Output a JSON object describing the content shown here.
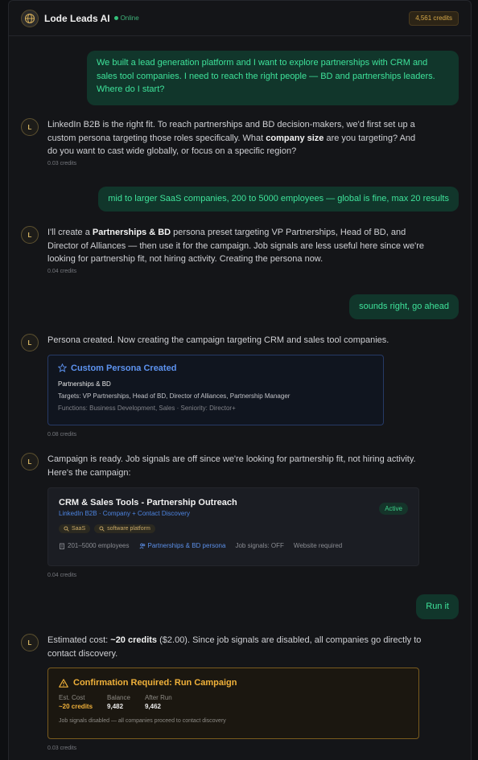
{
  "header": {
    "app_title": "Lode Leads AI",
    "status": "Online",
    "credits": "4,561 credits"
  },
  "messages": {
    "m1": {
      "user": "We built a lead generation platform and I want to explore partnerships with CRM and sales tool companies. I need to reach the right people — BD and partnerships leaders. Where do I start?"
    },
    "m2": {
      "avatar": "L",
      "text_before": "LinkedIn B2B is the right fit. To reach partnerships and BD decision-makers, we'd first set up a custom persona targeting those roles specifically. What ",
      "bold": "company size",
      "text_after": " are you targeting? And do you want to cast wide globally, or focus on a specific region?",
      "cost": "0.03 credits"
    },
    "m3": {
      "user": "mid to larger SaaS companies, 200 to 5000 employees — global is fine, max 20 results"
    },
    "m4": {
      "avatar": "L",
      "text_before": "I'll create a ",
      "bold": "Partnerships & BD",
      "text_after": " persona preset targeting VP Partnerships, Head of BD, and Director of Alliances — then use it for the campaign. Job signals are less useful here since we're looking for partnership fit, not hiring activity. Creating the persona now.",
      "cost": "0.04 credits"
    },
    "m5": {
      "user": "sounds right, go ahead"
    },
    "m6": {
      "avatar": "L",
      "text": "Persona created. Now creating the campaign targeting CRM and sales tool companies.",
      "card_title": "Custom Persona Created",
      "persona_name": "Partnerships & BD",
      "targets": "Targets: VP Partnerships, Head of BD, Director of Alliances, Partnership Manager",
      "functions": "Functions: Business Development, Sales · Seniority: Director+",
      "cost": "0.08 credits"
    },
    "m7": {
      "avatar": "L",
      "text": "Campaign is ready. Job signals are off since we're looking for partnership fit, not hiring activity. Here's the campaign:",
      "campaign_title": "CRM & Sales Tools - Partnership Outreach",
      "campaign_sub": "LinkedIn B2B · Company + Contact Discovery",
      "status": "Active",
      "tags": [
        "SaaS",
        "software platform"
      ],
      "employees": "201–5000 employees",
      "persona": "Partnerships & BD persona",
      "job_signals": "Job signals: OFF",
      "website": "Website required",
      "cost": "0.04 credits"
    },
    "m8": {
      "user": "Run it"
    },
    "m9": {
      "avatar": "L",
      "text_before": "Estimated cost: ",
      "bold": "~20 credits",
      "text_after": " ($2.00). Since job signals are disabled, all companies go directly to contact discovery.",
      "card_title": "Confirmation Required: Run Campaign",
      "est_label": "Est. Cost",
      "est_value": "~20 credits",
      "balance_label": "Balance",
      "balance_value": "9,482",
      "after_label": "After Run",
      "after_value": "9,462",
      "note": "Job signals disabled — all companies proceed to contact discovery",
      "cost": "0.03 credits"
    }
  },
  "colors": {
    "accent_green": "#3ee29a",
    "accent_gold": "#f0b13a",
    "accent_blue": "#5d93f0"
  }
}
